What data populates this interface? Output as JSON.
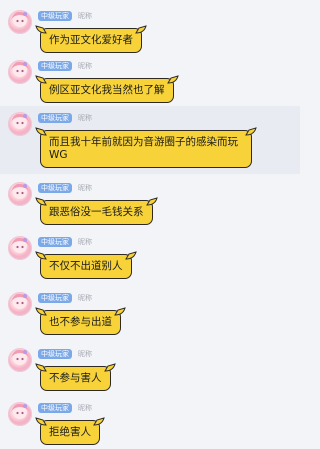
{
  "messages": [
    {
      "badge": "中级玩家",
      "nick": "昵称",
      "text": "作为亚文化爱好者"
    },
    {
      "badge": "中级玩家",
      "nick": "昵称",
      "text": "例区亚文化我当然也了解"
    },
    {
      "badge": "中级玩家",
      "nick": "昵称",
      "text": "而且我十年前就因为音游圈子的感染而玩WG"
    },
    {
      "badge": "中级玩家",
      "nick": "昵称",
      "text": "跟恶俗没一毛钱关系"
    },
    {
      "badge": "中级玩家",
      "nick": "昵称",
      "text": "不仅不出道别人"
    },
    {
      "badge": "中级玩家",
      "nick": "昵称",
      "text": "也不参与出道"
    },
    {
      "badge": "中级玩家",
      "nick": "昵称",
      "text": "不参与害人"
    },
    {
      "badge": "中级玩家",
      "nick": "昵称",
      "text": "拒绝害人"
    }
  ]
}
